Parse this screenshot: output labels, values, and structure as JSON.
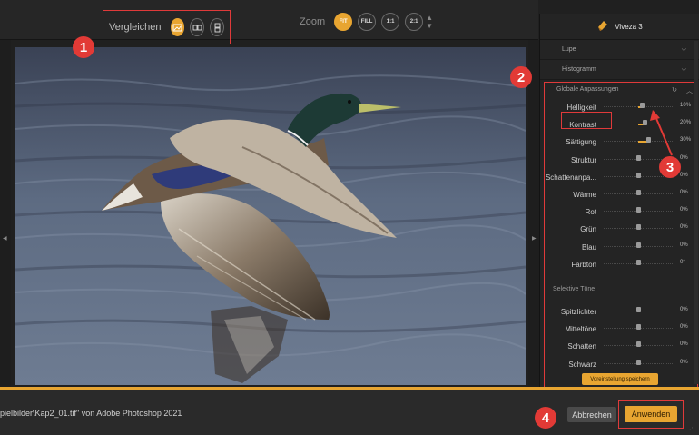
{
  "toolbar": {
    "compare_label": "Vergleichen",
    "zoom_label": "Zoom",
    "zoom_options": [
      "FIT",
      "FILL",
      "1:1",
      "2:1"
    ],
    "zoom_active": "FIT"
  },
  "panel": {
    "title": "Viveza 3",
    "accordions": [
      "Lupe",
      "Histogramm"
    ],
    "global_section": "Globale Anpassungen",
    "global_rows": [
      {
        "label": "Helligkeit",
        "value": "10",
        "unit": "%"
      },
      {
        "label": "Kontrast",
        "value": "20",
        "unit": "%"
      },
      {
        "label": "Sättigung",
        "value": "30",
        "unit": "%"
      },
      {
        "label": "Struktur",
        "value": "0",
        "unit": "%"
      },
      {
        "label": "Schattenanpa...",
        "value": "0",
        "unit": "%"
      },
      {
        "label": "Wärme",
        "value": "0",
        "unit": "%"
      },
      {
        "label": "Rot",
        "value": "0",
        "unit": "%"
      },
      {
        "label": "Grün",
        "value": "0",
        "unit": "%"
      },
      {
        "label": "Blau",
        "value": "0",
        "unit": "%"
      },
      {
        "label": "Farbton",
        "value": "0",
        "unit": "°"
      }
    ],
    "selective_section": "Selektive Töne",
    "selective_rows": [
      {
        "label": "Spitzlichter",
        "value": "0",
        "unit": "%"
      },
      {
        "label": "Mitteltöne",
        "value": "0",
        "unit": "%"
      },
      {
        "label": "Schatten",
        "value": "0",
        "unit": "%"
      },
      {
        "label": "Schwarz",
        "value": "0",
        "unit": "%"
      }
    ],
    "save_preset": "Voreinstellung speichern"
  },
  "bottom": {
    "file_text": "pielbilder\\Kap2_01.tif\" von Adobe Photoshop 2021",
    "cancel": "Abbrechen",
    "apply": "Anwenden"
  },
  "callouts": [
    "1",
    "2",
    "3",
    "4"
  ],
  "colors": {
    "accent": "#e8a531",
    "callout": "#e23a36"
  }
}
